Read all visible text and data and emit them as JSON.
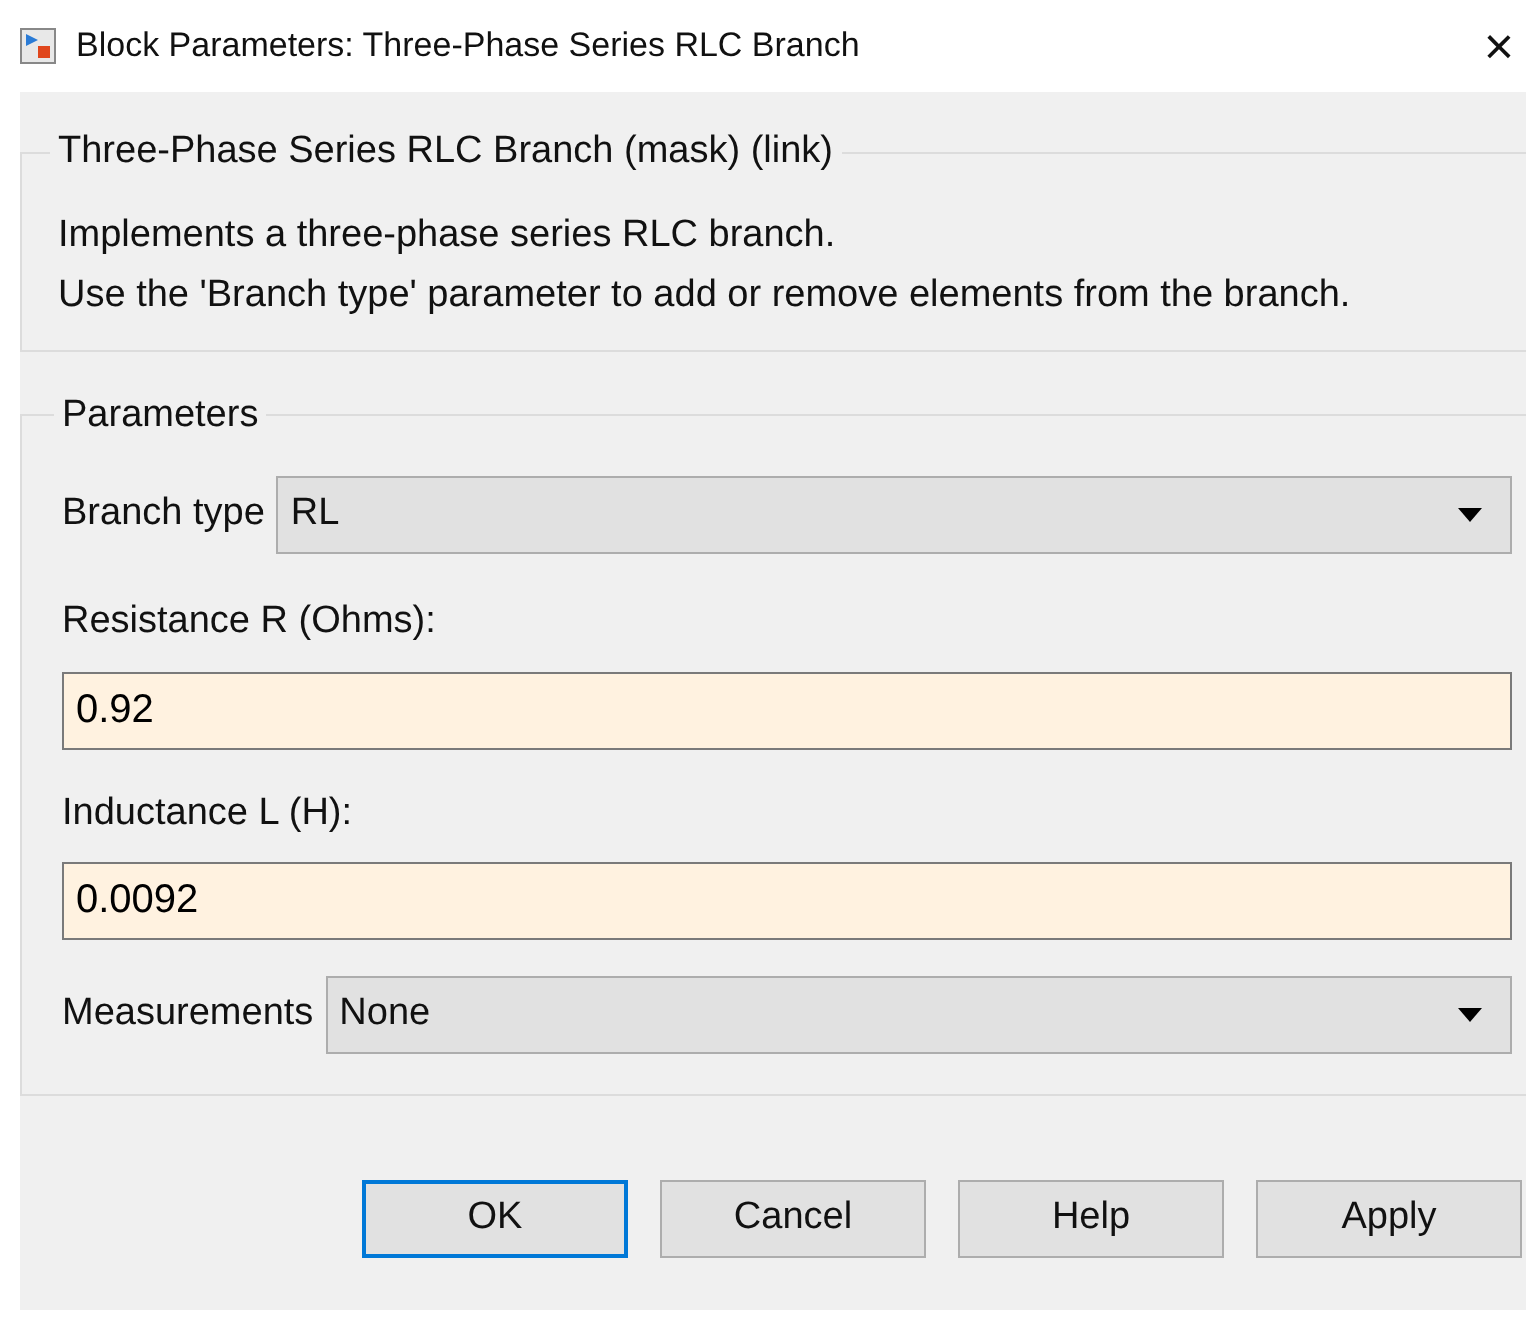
{
  "window": {
    "title": "Block Parameters: Three-Phase Series RLC Branch",
    "close": "×"
  },
  "description": {
    "title": "Three-Phase Series RLC Branch (mask) (link)",
    "text": [
      "Implements a three-phase series RLC branch.",
      "Use the 'Branch type' parameter to add or remove elements from the branch."
    ]
  },
  "parameters": {
    "title": "Parameters",
    "items": [
      {
        "kind": "dropdown",
        "label": "Branch type",
        "value": "RL"
      },
      {
        "kind": "field",
        "label": "Resistance R (Ohms):",
        "value": "0.92"
      },
      {
        "kind": "field",
        "label": "Inductance L (H):",
        "value": "0.0092"
      },
      {
        "kind": "dropdown",
        "label": "Measurements",
        "value": "None"
      }
    ]
  },
  "buttons": [
    {
      "label": "OK",
      "focused": true
    },
    {
      "label": "Cancel",
      "focused": false
    },
    {
      "label": "Help",
      "focused": false
    },
    {
      "label": "Apply",
      "focused": false
    }
  ]
}
